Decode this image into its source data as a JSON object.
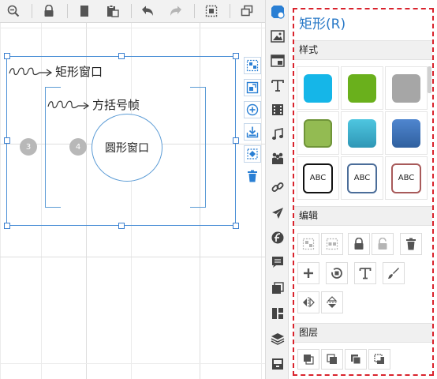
{
  "toolbar": {
    "buttons": [
      {
        "name": "zoom-out-icon"
      },
      {
        "name": "lock-icon"
      },
      {
        "name": "copy-icon"
      },
      {
        "name": "paste-icon"
      },
      {
        "name": "undo-icon"
      },
      {
        "name": "redo-icon"
      },
      {
        "name": "select-area-icon"
      },
      {
        "name": "duplicate-icon"
      }
    ]
  },
  "canvas": {
    "annotations": {
      "rect_label": "矩形窗口",
      "bracket_label": "方括号帧",
      "circle_label": "圆形窗口"
    },
    "badges": [
      "3",
      "4"
    ]
  },
  "rail": {
    "icons": [
      "shapes-icon",
      "image-icon",
      "window-icon",
      "text-icon",
      "video-icon",
      "music-icon",
      "people-icon",
      "link-icon",
      "plane-icon",
      "flash-icon",
      "chat-icon",
      "pages-icon",
      "layout-icon",
      "layers-icon",
      "archive-icon"
    ]
  },
  "panel": {
    "title": "矩形(R)",
    "sections": {
      "style": "样式",
      "edit": "编辑",
      "layer": "图层"
    },
    "style_swatches": [
      {
        "type": "fill",
        "color": "#15b6e8"
      },
      {
        "type": "fill",
        "color": "#6ab01c"
      },
      {
        "type": "fill",
        "color": "#a6a6a6"
      },
      {
        "type": "fill",
        "color": "#93bb52"
      },
      {
        "type": "fill",
        "color": "#33a9c8"
      },
      {
        "type": "fill",
        "color": "#3e71b8"
      },
      {
        "type": "outline",
        "label": "ABC",
        "color": "#111111"
      },
      {
        "type": "outline",
        "label": "ABC",
        "color": "#4b6d99"
      },
      {
        "type": "outline",
        "label": "ABC",
        "color": "#a85a5a"
      }
    ]
  },
  "colors": {
    "accent_blue": "#2979c7",
    "selection_blue": "#4a8fd6",
    "highlight_red": "#d9232d"
  }
}
